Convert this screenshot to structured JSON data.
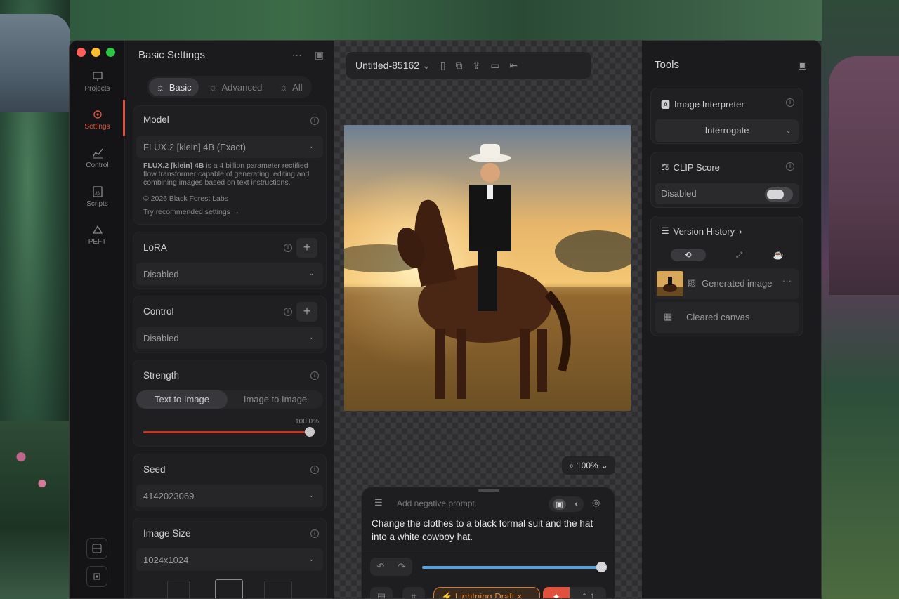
{
  "window": {
    "rail": [
      {
        "label": "Projects",
        "icon": "projects-icon"
      },
      {
        "label": "Settings",
        "icon": "settings-icon",
        "active": true
      },
      {
        "label": "Control",
        "icon": "control-icon"
      },
      {
        "label": "Scripts",
        "icon": "scripts-icon"
      },
      {
        "label": "PEFT",
        "icon": "peft-icon"
      }
    ]
  },
  "settings": {
    "title": "Basic Settings",
    "tabs": [
      "Basic",
      "Advanced",
      "All"
    ],
    "model": {
      "title": "Model",
      "value": "FLUX.2 [klein] 4B (Exact)",
      "desc_name": "FLUX.2 [klein] 4B",
      "desc_rest": " is a 4 billion parameter rectified flow transformer capable of generating, editing and combining images based on text instructions.",
      "copyright": "© 2026 Black Forest Labs",
      "try_link": "Try recommended settings →"
    },
    "lora": {
      "title": "LoRA",
      "value": "Disabled"
    },
    "control": {
      "title": "Control",
      "value": "Disabled"
    },
    "strength": {
      "title": "Strength",
      "tab_active": "Text to Image",
      "tab_other": "Image to Image",
      "value": "100.0%",
      "fraction": 1.0
    },
    "seed": {
      "title": "Seed",
      "value": "4142023069"
    },
    "image_size": {
      "title": "Image Size",
      "value": "1024x1024"
    }
  },
  "canvas": {
    "doc_title": "Untitled-85162",
    "zoom": "100%",
    "prompt": {
      "negative_placeholder": "Add negative prompt.",
      "text": "Change the clothes to a black formal suit and the hat into a white cowboy hat."
    },
    "lightning_chip": "Lightning Draft",
    "count": "1"
  },
  "tools": {
    "title": "Tools",
    "interpreter": {
      "title": "Image Interpreter",
      "value": "Interrogate"
    },
    "clip": {
      "title": "CLIP Score",
      "value": "Disabled"
    },
    "history": {
      "title": "Version History",
      "items": [
        {
          "label": "Generated image"
        },
        {
          "label": "Cleared canvas"
        }
      ]
    }
  },
  "colors": {
    "accent": "#e0523d",
    "steps": "#5aa0d8",
    "draft": "#d87b30"
  }
}
